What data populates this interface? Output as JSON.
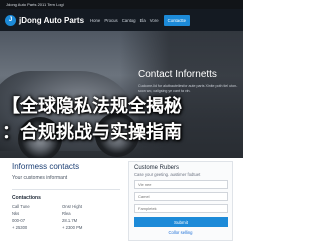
{
  "topbar": {
    "text": "Jdong Auto Parts 2011 Tern Logi"
  },
  "nav": {
    "logo_letter": "J",
    "brand": "jDong Auto Parts",
    "links": [
      "Hone",
      "Procus",
      "Cantog",
      "Ela",
      "Vore"
    ],
    "cta": "Contactte"
  },
  "hero": {
    "title": "Contact Infornetts",
    "subtitle": "Cuckone-lid for alutbauteilesfor aute parts Xinite poth tiel uton-soon wo, caiigsing ye cant ta vin."
  },
  "overlay": {
    "line1": "【全球隐私法规全揭秘",
    "line2": "：合规挑战与实操指南"
  },
  "contacts": {
    "title": "Informess contacts",
    "subtitle": "Your customes informant",
    "hours_title": "Contactions",
    "hours": [
      [
        "Call Tune",
        "Onsr Hight"
      ],
      [
        "Nks",
        "Rlea"
      ],
      [
        "000-07",
        "28.1.7M"
      ],
      [
        "+ 25300",
        "+ 2300 PM"
      ]
    ]
  },
  "form": {
    "title": "Custome Rubers",
    "subtitle": "Case your geeting. austimer fodtuet",
    "fields": [
      "Vie nee",
      "Camel",
      "Fampletek"
    ],
    "submit": "Submit",
    "link": "Collor selling"
  },
  "colors": {
    "accent": "#1c8ad8",
    "nav_bg": "#141a22",
    "heading": "#1c3f74"
  }
}
